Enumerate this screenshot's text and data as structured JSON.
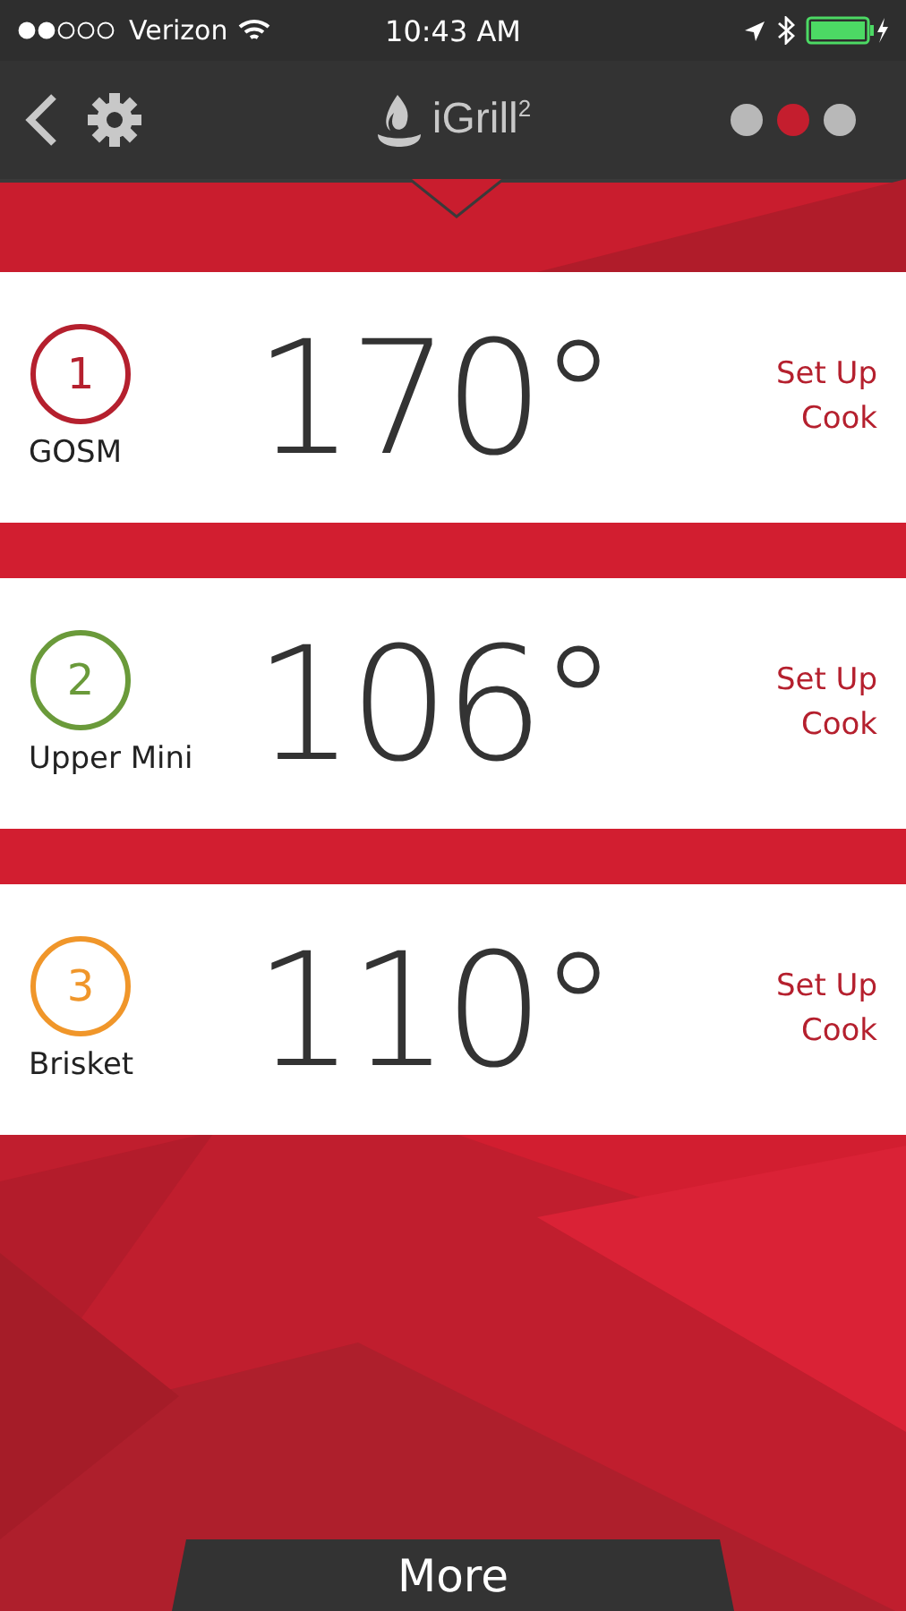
{
  "status_bar": {
    "carrier": "Verizon",
    "time": "10:43 AM"
  },
  "nav_bar": {
    "logo": "iGrill$^{2}$",
    "pages": [
      {
        "selected": false
      },
      {
        "selected": true
      },
      {
        "selected": false
      }
    ]
  },
  "probes": [
    {
      "number": "1",
      "name": "GOSM",
      "temperature": "170°",
      "action": "Set Up Cook",
      "color": "#b5202e"
    },
    {
      "number": "2",
      "name": "Upper Mini",
      "temperature": "106°",
      "action": "Set Up Cook",
      "color": "#6a9a3a"
    },
    {
      "number": "3",
      "name": "Brisket",
      "temperature": "110°",
      "action": "Set Up Cook",
      "color": "#f0962a"
    }
  ],
  "more_button": "More"
}
